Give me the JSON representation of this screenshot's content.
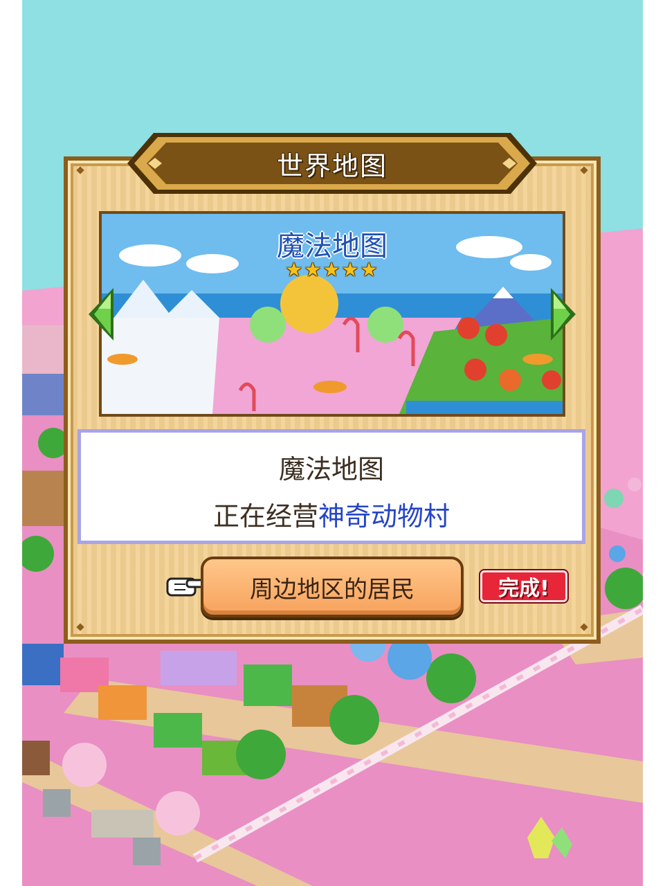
{
  "dialog": {
    "title": "世界地图",
    "map_preview": {
      "name": "魔法地图",
      "rating_stars": "★★★★★"
    },
    "info": {
      "map_name": "魔法地图",
      "status_prefix": "正在经营",
      "village_name": "神奇动物村"
    },
    "action_button_label": "周边地区的居民",
    "completed_badge": "完成!"
  },
  "colors": {
    "sky": "#8ee0e2",
    "ground_pink": "#f2a3d0",
    "frame_wood": "#f3d193",
    "frame_border": "#8d5d1c",
    "title_plate": "#7a5216",
    "highlight_blue": "#2445c7",
    "button_orange": "#f7a25c",
    "badge_red": "#e8263a",
    "arrow_green": "#5cc13a"
  },
  "icons": [
    "left-arrow-icon",
    "right-arrow-icon",
    "pointing-hand-icon",
    "star-icon"
  ]
}
